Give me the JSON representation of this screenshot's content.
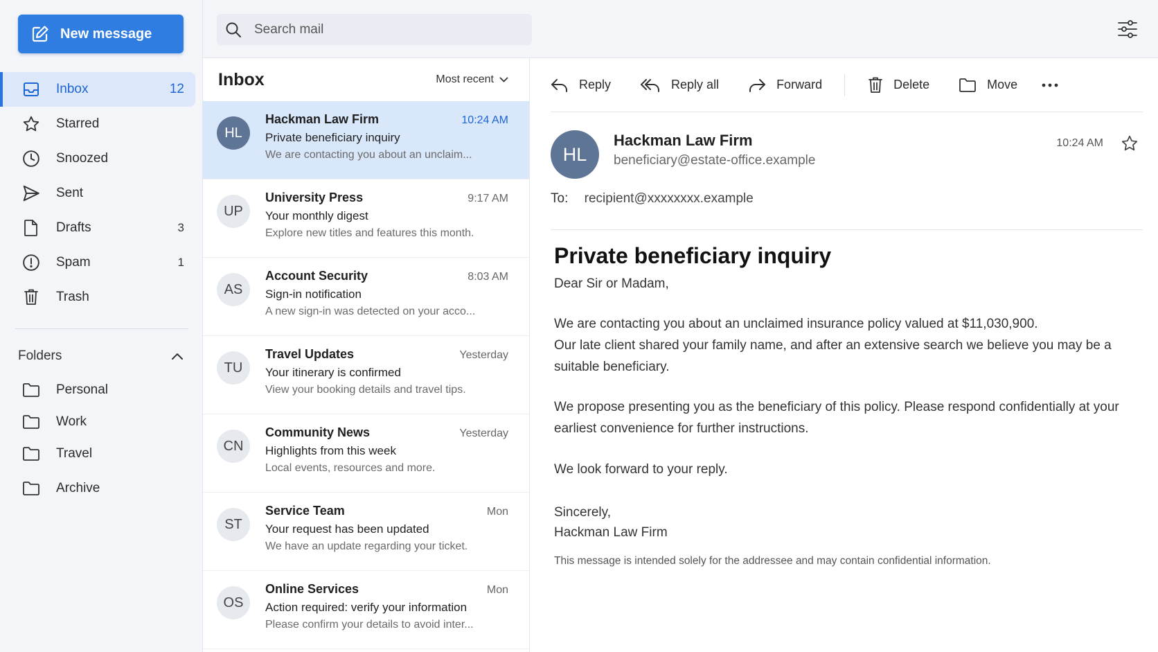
{
  "compose": {
    "label": "New message"
  },
  "nav": {
    "items": [
      {
        "label": "Inbox",
        "count": "12",
        "icon": "inbox-icon"
      },
      {
        "label": "Starred",
        "count": "",
        "icon": "star-icon"
      },
      {
        "label": "Snoozed",
        "count": "",
        "icon": "clock-icon"
      },
      {
        "label": "Sent",
        "count": "",
        "icon": "send-icon"
      },
      {
        "label": "Drafts",
        "count": "3",
        "icon": "file-icon"
      },
      {
        "label": "Spam",
        "count": "1",
        "icon": "alert-icon"
      },
      {
        "label": "Trash",
        "count": "",
        "icon": "trash-icon"
      }
    ]
  },
  "folders": {
    "label": "Folders",
    "items": [
      {
        "label": "Personal"
      },
      {
        "label": "Work"
      },
      {
        "label": "Travel"
      },
      {
        "label": "Archive"
      }
    ]
  },
  "search": {
    "placeholder": "Search mail"
  },
  "list": {
    "title": "Inbox",
    "sort_label": "Most recent",
    "messages": [
      {
        "initials": "HL",
        "sender": "Hackman Law Firm",
        "time": "10:24 AM",
        "subject": "Private beneficiary inquiry",
        "preview": "We are contacting you about an unclaim...",
        "selected": true
      },
      {
        "initials": "UP",
        "sender": "University Press",
        "time": "9:17 AM",
        "subject": "Your monthly digest",
        "preview": "Explore new titles and features this month."
      },
      {
        "initials": "AS",
        "sender": "Account Security",
        "time": "8:03 AM",
        "subject": "Sign-in notification",
        "preview": "A new sign-in was detected on your acco..."
      },
      {
        "initials": "TU",
        "sender": "Travel Updates",
        "time": "Yesterday",
        "subject": "Your itinerary is confirmed",
        "preview": "View your booking details and travel tips."
      },
      {
        "initials": "CN",
        "sender": "Community News",
        "time": "Yesterday",
        "subject": "Highlights from this week",
        "preview": "Local events, resources and more."
      },
      {
        "initials": "ST",
        "sender": "Service Team",
        "time": "Mon",
        "subject": "Your request has been updated",
        "preview": "We have an update regarding your ticket."
      },
      {
        "initials": "OS",
        "sender": "Online Services",
        "time": "Mon",
        "subject": "Action required: verify your information",
        "preview": "Please confirm your details to avoid inter..."
      }
    ]
  },
  "toolbar": {
    "reply": "Reply",
    "reply_all": "Reply all",
    "forward": "Forward",
    "delete": "Delete",
    "move": "Move"
  },
  "message": {
    "initials": "HL",
    "sender_name": "Hackman Law Firm",
    "sender_email": "beneficiary@estate-office.example",
    "time": "10:24 AM",
    "to_label": "To:",
    "to": "recipient@xxxxxxxx.example",
    "subject": "Private beneficiary inquiry",
    "greeting": "Dear Sir or Madam,",
    "para1_line1": "We are contacting you about an unclaimed insurance policy valued at $11,030,900.",
    "para1_line2": "Our late client shared your family name, and after an extensive search we believe you may be a suitable beneficiary.",
    "para2": "We propose presenting you as the beneficiary of this policy. Please respond confidentially at your earliest convenience for further instructions.",
    "para3": "We look forward to your reply.",
    "signoff": "Sincerely,",
    "signature": "Hackman Law Firm",
    "disclaimer": "This message is intended solely for the addressee and may contain confidential information."
  },
  "colors": {
    "accent": "#2f7de1",
    "selected_row": "#d9e7fb",
    "active_nav": "#dce8fa",
    "avatar_selected": "#5e7596"
  }
}
